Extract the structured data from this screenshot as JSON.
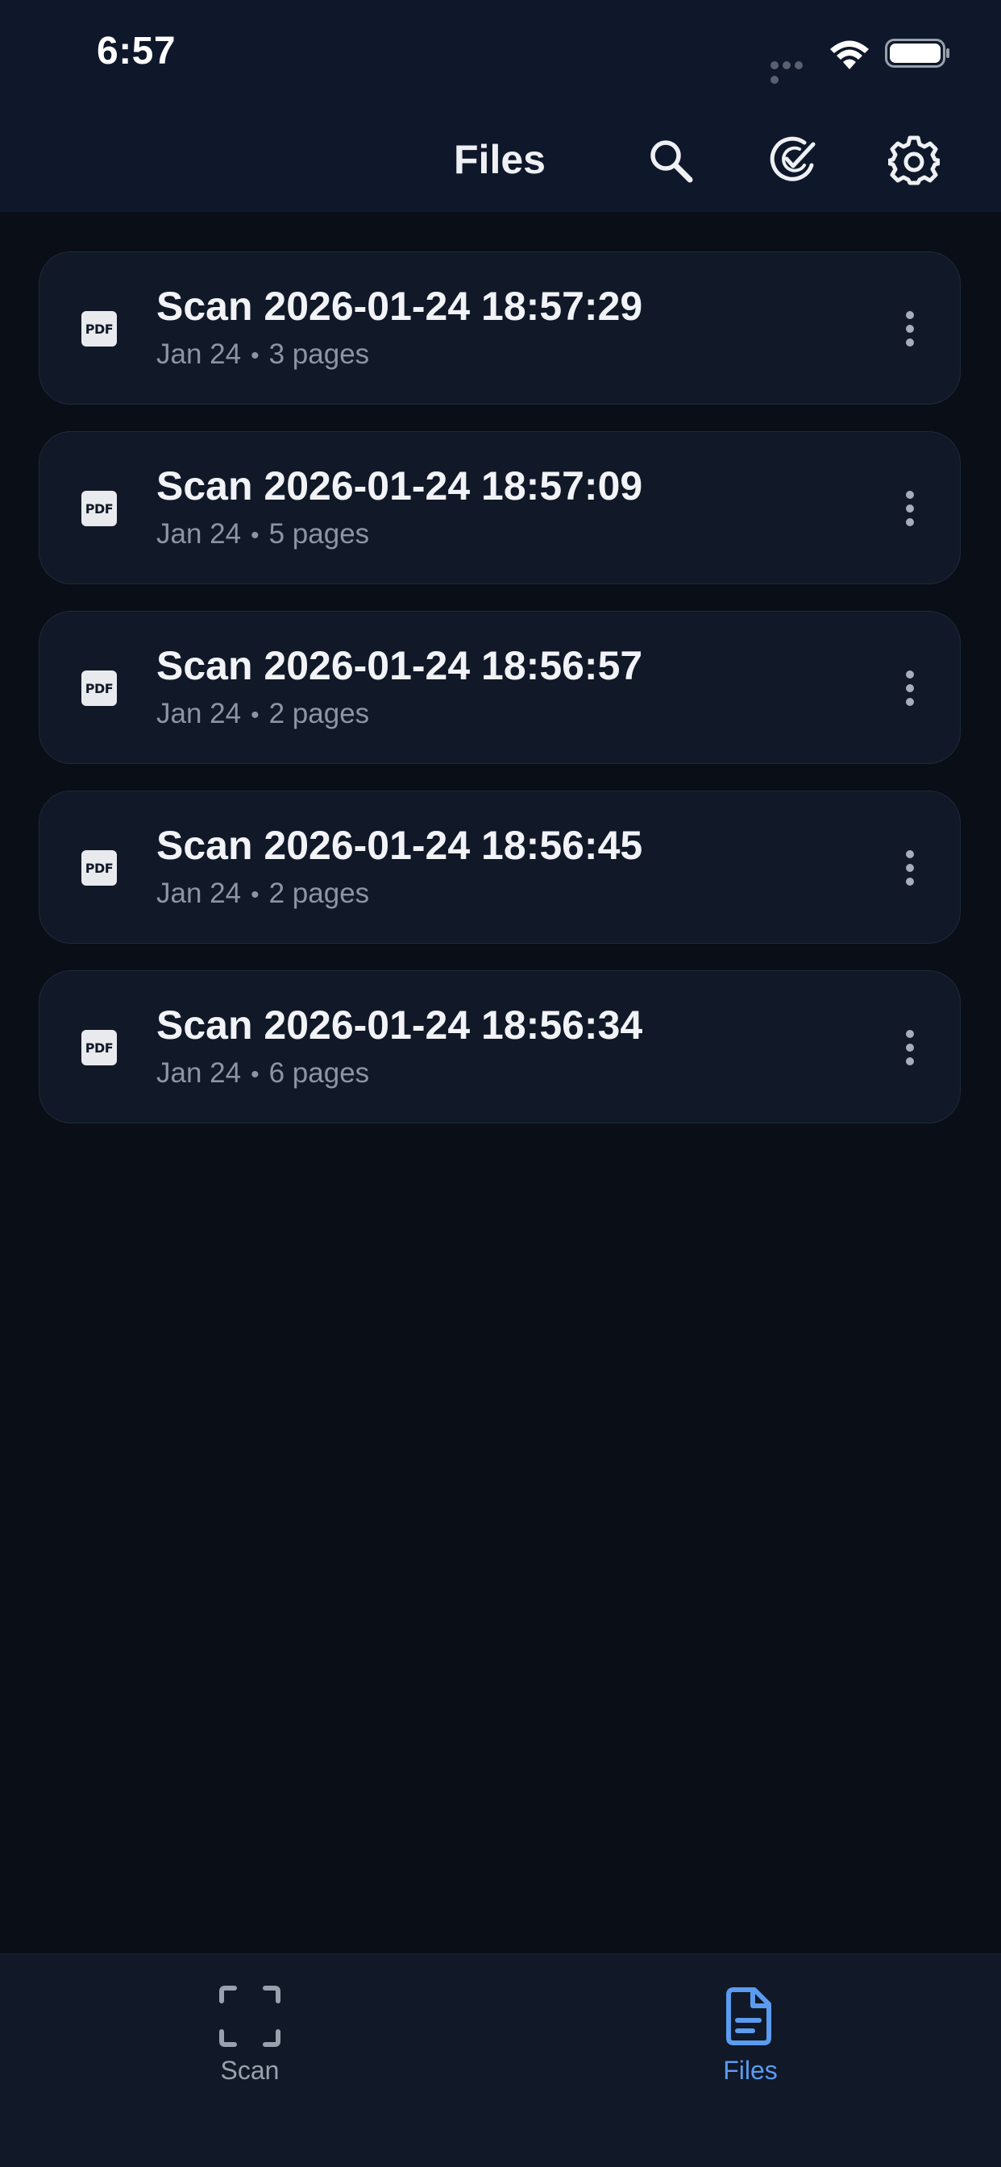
{
  "status_bar": {
    "time": "6:57"
  },
  "header": {
    "title": "Files",
    "icons": [
      "search-icon",
      "select-check-icon",
      "gear-icon"
    ]
  },
  "files": [
    {
      "name": "Scan 2026-01-24 18:57:29",
      "date": "Jan 24",
      "pages": "3 pages",
      "type_label": "PDF"
    },
    {
      "name": "Scan 2026-01-24 18:57:09",
      "date": "Jan 24",
      "pages": "5 pages",
      "type_label": "PDF"
    },
    {
      "name": "Scan 2026-01-24 18:56:57",
      "date": "Jan 24",
      "pages": "2 pages",
      "type_label": "PDF"
    },
    {
      "name": "Scan 2026-01-24 18:56:45",
      "date": "Jan 24",
      "pages": "2 pages",
      "type_label": "PDF"
    },
    {
      "name": "Scan 2026-01-24 18:56:34",
      "date": "Jan 24",
      "pages": "6 pages",
      "type_label": "PDF"
    }
  ],
  "bottom_nav": {
    "items": [
      {
        "label": "Scan",
        "icon": "scan-frame-icon",
        "active": false
      },
      {
        "label": "Files",
        "icon": "file-document-icon",
        "active": true
      }
    ]
  },
  "colors": {
    "background": "#0a0e16",
    "surface": "#111827",
    "accent": "#5b9bf0",
    "text_primary": "#f1f3f7",
    "text_secondary": "#8d94a3"
  }
}
